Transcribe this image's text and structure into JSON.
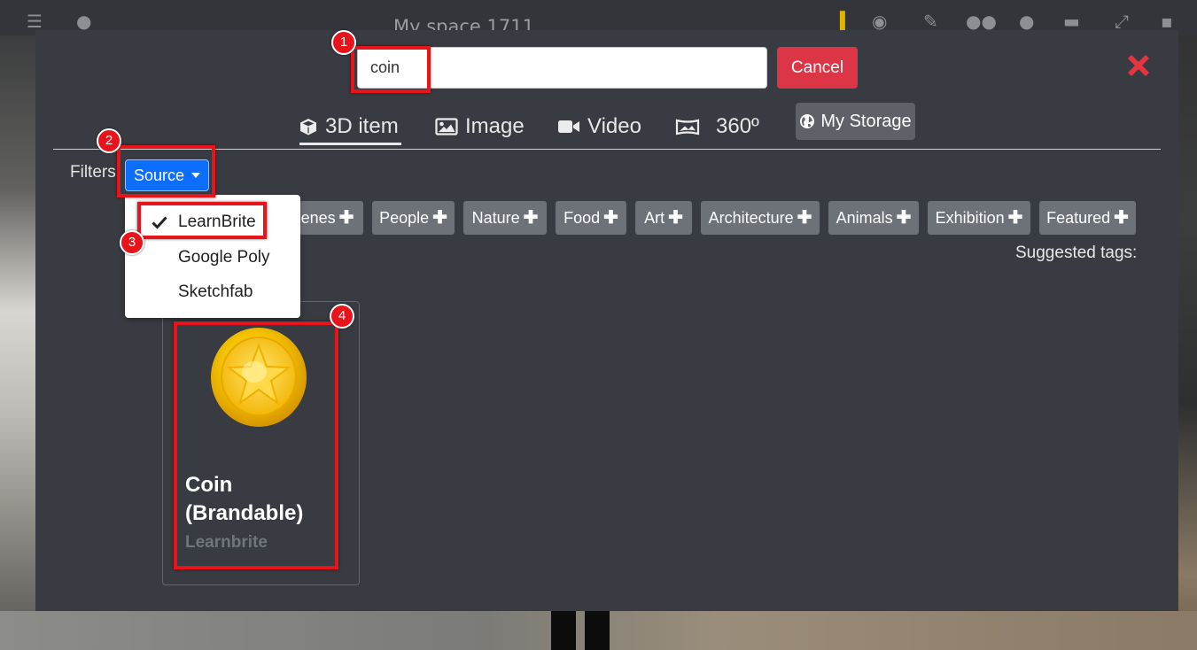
{
  "background": {
    "space_title": "My space 1711"
  },
  "search": {
    "value": "coin",
    "cancel_label": "Cancel",
    "close_icon": "close-x-icon"
  },
  "tabs": [
    {
      "label": "3D item",
      "icon": "cube-icon",
      "active": true
    },
    {
      "label": "Image",
      "icon": "image-icon",
      "active": false
    },
    {
      "label": "Video",
      "icon": "video-camera-icon",
      "active": false
    },
    {
      "label": "360º",
      "icon": "panorama-icon",
      "active": false
    }
  ],
  "storage": {
    "label": "My Storage",
    "icon": "globe-icon"
  },
  "filters": {
    "label": "Filters",
    "source_label": "Source",
    "source_options": [
      {
        "label": "LearnBrite",
        "checked": true
      },
      {
        "label": "Google Poly",
        "checked": false
      },
      {
        "label": "Sketchfab",
        "checked": false
      }
    ]
  },
  "tags": [
    {
      "label": "Scenes"
    },
    {
      "label": "People"
    },
    {
      "label": "Nature"
    },
    {
      "label": "Food"
    },
    {
      "label": "Art"
    },
    {
      "label": "Architecture"
    },
    {
      "label": "Animals"
    },
    {
      "label": "Exhibition"
    },
    {
      "label": "Featured"
    }
  ],
  "tag_plus": "✚",
  "suggested_label": "Suggested tags:",
  "results": [
    {
      "title": "Coin (Brandable)",
      "source": "Learnbrite",
      "thumbnail": "gold-star-coin"
    }
  ],
  "annotations": [
    "1",
    "2",
    "3",
    "4"
  ],
  "colors": {
    "modal_bg": "#383b41",
    "cancel": "#dc3545",
    "source_button": "#0d6efd",
    "tag_bg": "#6d7178",
    "annotation": "#e8141c",
    "close_x": "#e8343f"
  }
}
